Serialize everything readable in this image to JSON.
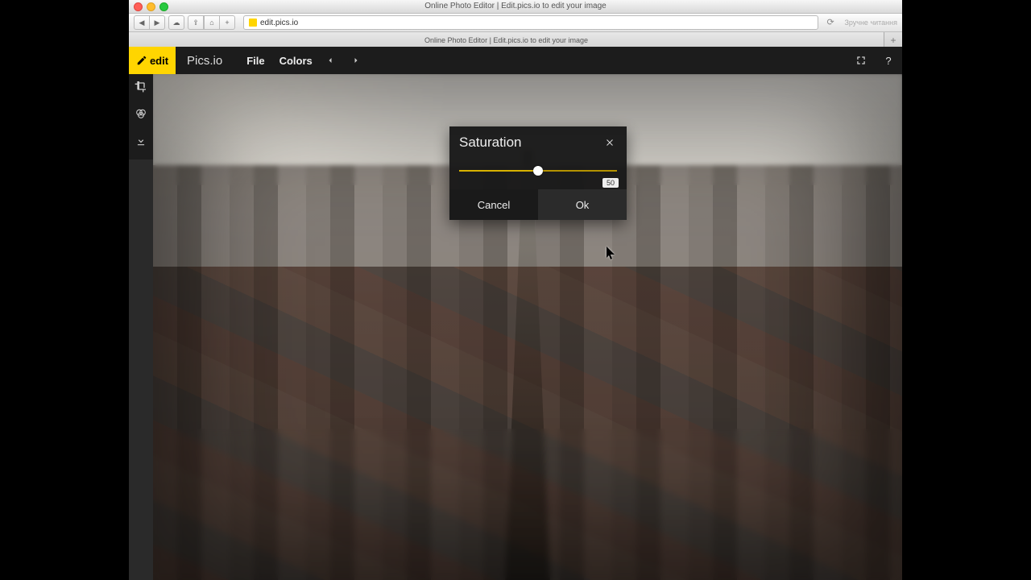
{
  "window": {
    "title": "Online Photo Editor | Edit.pics.io to edit your image",
    "address": "edit.pics.io",
    "reader_label": "Зручне читання",
    "tab_title": "Online Photo Editor | Edit.pics.io to edit your image"
  },
  "brand": {
    "edit": "edit",
    "name": "Pics.io"
  },
  "menu": {
    "file": "File",
    "colors": "Colors"
  },
  "topbar": {
    "help": "?"
  },
  "dialog": {
    "title": "Saturation",
    "value": "50",
    "cancel": "Cancel",
    "ok": "Ok"
  }
}
